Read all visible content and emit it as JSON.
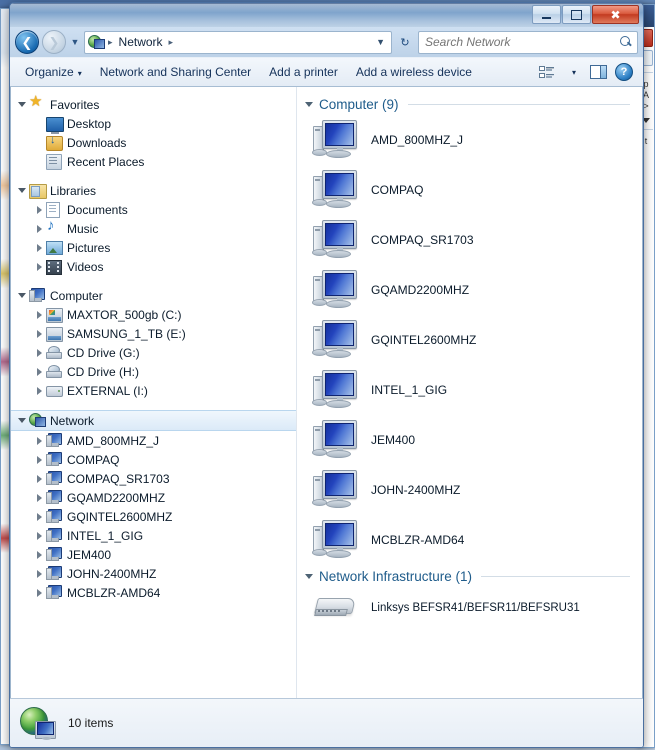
{
  "window": {
    "minimize_label": "Minimize",
    "maximize_label": "Maximize",
    "close_label": "Close"
  },
  "address": {
    "back_label": "Back",
    "forward_label": "Forward",
    "history_label": "Recent pages",
    "breadcrumb_root": "Network",
    "breadcrumb_sep": "▸",
    "dropdown_label": "▾",
    "refresh_label": "↻"
  },
  "search": {
    "placeholder": "Search Network",
    "value": "",
    "icon": "search-icon"
  },
  "toolbar": {
    "organize": "Organize",
    "organize_caret": "▾",
    "network_sharing_center": "Network and Sharing Center",
    "add_printer": "Add a printer",
    "add_wireless_device": "Add a wireless device",
    "view_caret": "▾",
    "view_icon": "change-view-icon",
    "preview_pane_icon": "preview-pane-icon",
    "help_icon": "help-icon",
    "help_glyph": "?"
  },
  "sidebar": {
    "groups": [
      {
        "name": "Favorites",
        "icon": "favorites-star-icon",
        "expanded": true,
        "items": [
          {
            "label": "Desktop",
            "icon": "desktop-icon",
            "expandable": false
          },
          {
            "label": "Downloads",
            "icon": "downloads-icon",
            "expandable": false
          },
          {
            "label": "Recent Places",
            "icon": "recent-places-icon",
            "expandable": false
          }
        ]
      },
      {
        "name": "Libraries",
        "icon": "libraries-icon",
        "expanded": true,
        "items": [
          {
            "label": "Documents",
            "icon": "documents-icon",
            "expandable": true
          },
          {
            "label": "Music",
            "icon": "music-icon",
            "expandable": true
          },
          {
            "label": "Pictures",
            "icon": "pictures-icon",
            "expandable": true
          },
          {
            "label": "Videos",
            "icon": "videos-icon",
            "expandable": true
          }
        ]
      },
      {
        "name": "Computer",
        "icon": "computer-icon",
        "expanded": true,
        "items": [
          {
            "label": "MAXTOR_500gb (C:)",
            "icon": "system-drive-icon",
            "expandable": true
          },
          {
            "label": "SAMSUNG_1_TB (E:)",
            "icon": "hard-drive-icon",
            "expandable": true
          },
          {
            "label": "CD Drive (G:)",
            "icon": "cd-drive-icon",
            "expandable": true
          },
          {
            "label": "CD Drive (H:)",
            "icon": "cd-drive-icon",
            "expandable": true
          },
          {
            "label": "EXTERNAL (I:)",
            "icon": "external-drive-icon",
            "expandable": true
          }
        ]
      },
      {
        "name": "Network",
        "icon": "network-icon",
        "expanded": true,
        "selected": true,
        "items": [
          {
            "label": "AMD_800MHZ_J",
            "icon": "computer-node-icon",
            "expandable": true
          },
          {
            "label": "COMPAQ",
            "icon": "computer-node-icon",
            "expandable": true
          },
          {
            "label": "COMPAQ_SR1703",
            "icon": "computer-node-icon",
            "expandable": true
          },
          {
            "label": "GQAMD2200MHZ",
            "icon": "computer-node-icon",
            "expandable": true
          },
          {
            "label": "GQINTEL2600MHZ",
            "icon": "computer-node-icon",
            "expandable": true
          },
          {
            "label": "INTEL_1_GIG",
            "icon": "computer-node-icon",
            "expandable": true
          },
          {
            "label": "JEM400",
            "icon": "computer-node-icon",
            "expandable": true
          },
          {
            "label": "JOHN-2400MHZ",
            "icon": "computer-node-icon",
            "expandable": true
          },
          {
            "label": "MCBLZR-AMD64",
            "icon": "computer-node-icon",
            "expandable": true
          }
        ]
      }
    ]
  },
  "content": {
    "groups": [
      {
        "header": "Computer (9)",
        "count": 9,
        "items": [
          {
            "name": "AMD_800MHZ_J",
            "icon": "computer-icon"
          },
          {
            "name": "COMPAQ",
            "icon": "computer-icon"
          },
          {
            "name": "COMPAQ_SR1703",
            "icon": "computer-icon"
          },
          {
            "name": "GQAMD2200MHZ",
            "icon": "computer-icon"
          },
          {
            "name": "GQINTEL2600MHZ",
            "icon": "computer-icon"
          },
          {
            "name": "INTEL_1_GIG",
            "icon": "computer-icon"
          },
          {
            "name": "JEM400",
            "icon": "computer-icon"
          },
          {
            "name": "JOHN-2400MHZ",
            "icon": "computer-icon"
          },
          {
            "name": "MCBLZR-AMD64",
            "icon": "computer-icon"
          }
        ]
      },
      {
        "header": "Network Infrastructure (1)",
        "count": 1,
        "items": [
          {
            "name": "Linksys BEFSR41/BEFSR11/BEFSRU31",
            "icon": "router-icon"
          }
        ]
      }
    ]
  },
  "status": {
    "icon": "network-status-icon",
    "text": "10 items"
  },
  "colors": {
    "group_header": "#1f5c8b",
    "selection": "#dbeaf8",
    "close_button": "#c23a20",
    "accent": "#2b7ec4"
  }
}
